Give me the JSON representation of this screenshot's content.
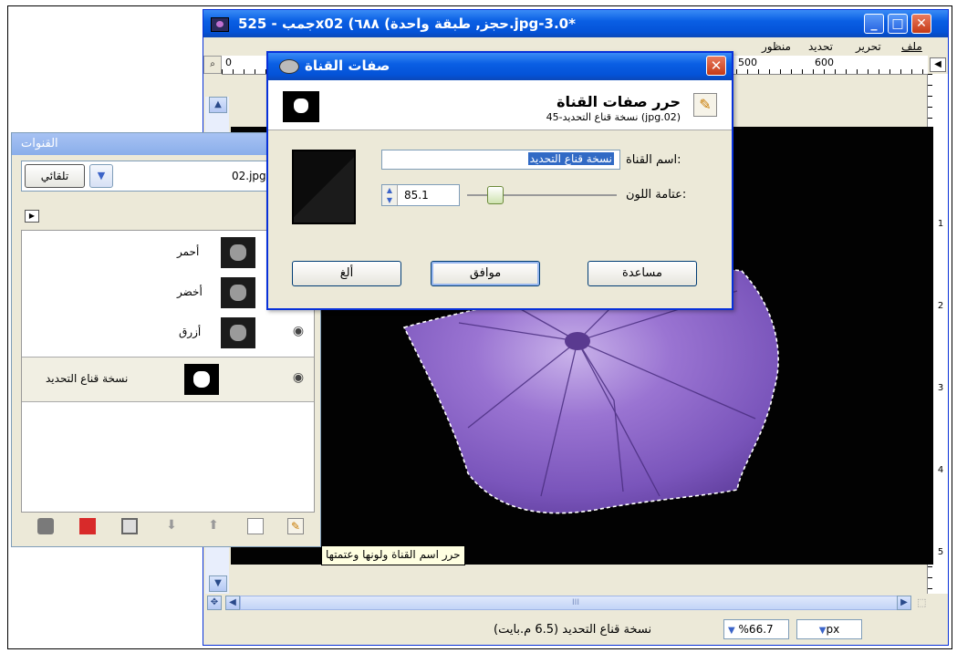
{
  "main_window": {
    "title": "جمب - 525x‏حجز, طبقة واحدة) ٦٨٨) 02.jpg-3.0*",
    "menu": [
      "ملف",
      "تحرير",
      "تحديد",
      "منظور"
    ],
    "ruler_top_labels": [
      "0",
      "500",
      "600"
    ],
    "ruler_right_labels": [
      "1",
      "2",
      "3",
      "4",
      "5"
    ],
    "status_text": "نسخة قناع التحديد (6.5 م.بايت)",
    "zoom": "%66.7",
    "unit": "px",
    "hscroll_grip": "III"
  },
  "dock": {
    "title": "القنوات",
    "image_name": "02.jpg",
    "auto_button": "تلقائي",
    "channels": [
      {
        "label": "أحمر",
        "visible": false
      },
      {
        "label": "أخضر",
        "visible": false
      },
      {
        "label": "أزرق",
        "visible": true
      },
      {
        "label": "نسخة قناع التحديد",
        "visible": true,
        "selected": true
      }
    ]
  },
  "tooltip": "حرر اسم القناة ولونها وعتمتها",
  "dialog": {
    "title": "صفات القناة",
    "header_title": "حرر صفات القناة",
    "header_subtitle": "نسخة قناع التحديد-45 (jpg.02)",
    "name_label": "اسم القناة:",
    "name_value": "نسخة قناع التحديد",
    "opacity_label": "عتامة اللون:",
    "opacity_value": "85.1",
    "opacity_percent": 85.1,
    "buttons": {
      "help": "مساعدة",
      "ok": "موافق",
      "cancel": "ألغ"
    }
  },
  "colors": {
    "xp_blue": "#0453d8",
    "petal_purple": "#8a63c4",
    "canvas_bg": "#020202"
  }
}
